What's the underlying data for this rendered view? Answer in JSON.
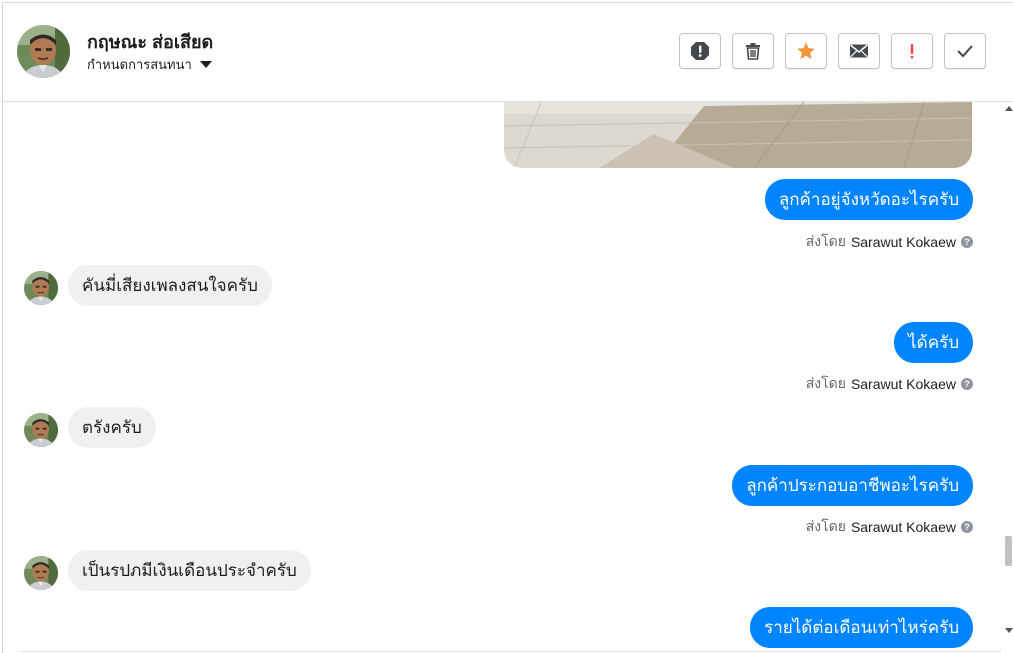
{
  "header": {
    "contact_name": "กฤษณะ ส่อเสียด",
    "conversation_settings": "กำหนดการสนทนา",
    "toolbar": [
      {
        "name": "spam-button",
        "icon": "octagon-exclamation-icon"
      },
      {
        "name": "delete-button",
        "icon": "trash-icon"
      },
      {
        "name": "star-button",
        "icon": "star-icon",
        "color": "#f7923a"
      },
      {
        "name": "email-button",
        "icon": "envelope-icon"
      },
      {
        "name": "follow-up-button",
        "icon": "exclamation-icon",
        "color": "#fa3e3e"
      },
      {
        "name": "done-button",
        "icon": "checkmark-icon"
      }
    ]
  },
  "messages": [
    {
      "direction": "out",
      "text": "ลูกค้าอยู่จังหวัดอะไรครับ",
      "sent_by_label": "ส่งโดย",
      "agent": "Sarawut Kokaew"
    },
    {
      "direction": "in",
      "text": "คันมี่เสียงเพลงสนใจครับ"
    },
    {
      "direction": "out",
      "text": "ได้ครับ",
      "sent_by_label": "ส่งโดย",
      "agent": "Sarawut Kokaew"
    },
    {
      "direction": "in",
      "text": "ตรังครับ"
    },
    {
      "direction": "out",
      "text": "ลูกค้าประกอบอาชีพอะไรครับ",
      "sent_by_label": "ส่งโดย",
      "agent": "Sarawut Kokaew"
    },
    {
      "direction": "in",
      "text": "เป็นรปภมีเงินเดือนประจำครับ"
    },
    {
      "direction": "out",
      "text": "รายได้ต่อเดือนเท่าไหร่ครับ"
    }
  ],
  "colors": {
    "outgoing_bubble": "#0084ff",
    "incoming_bubble": "#f0f0f0",
    "star": "#f7923a",
    "follow_up": "#fa3e3e"
  }
}
